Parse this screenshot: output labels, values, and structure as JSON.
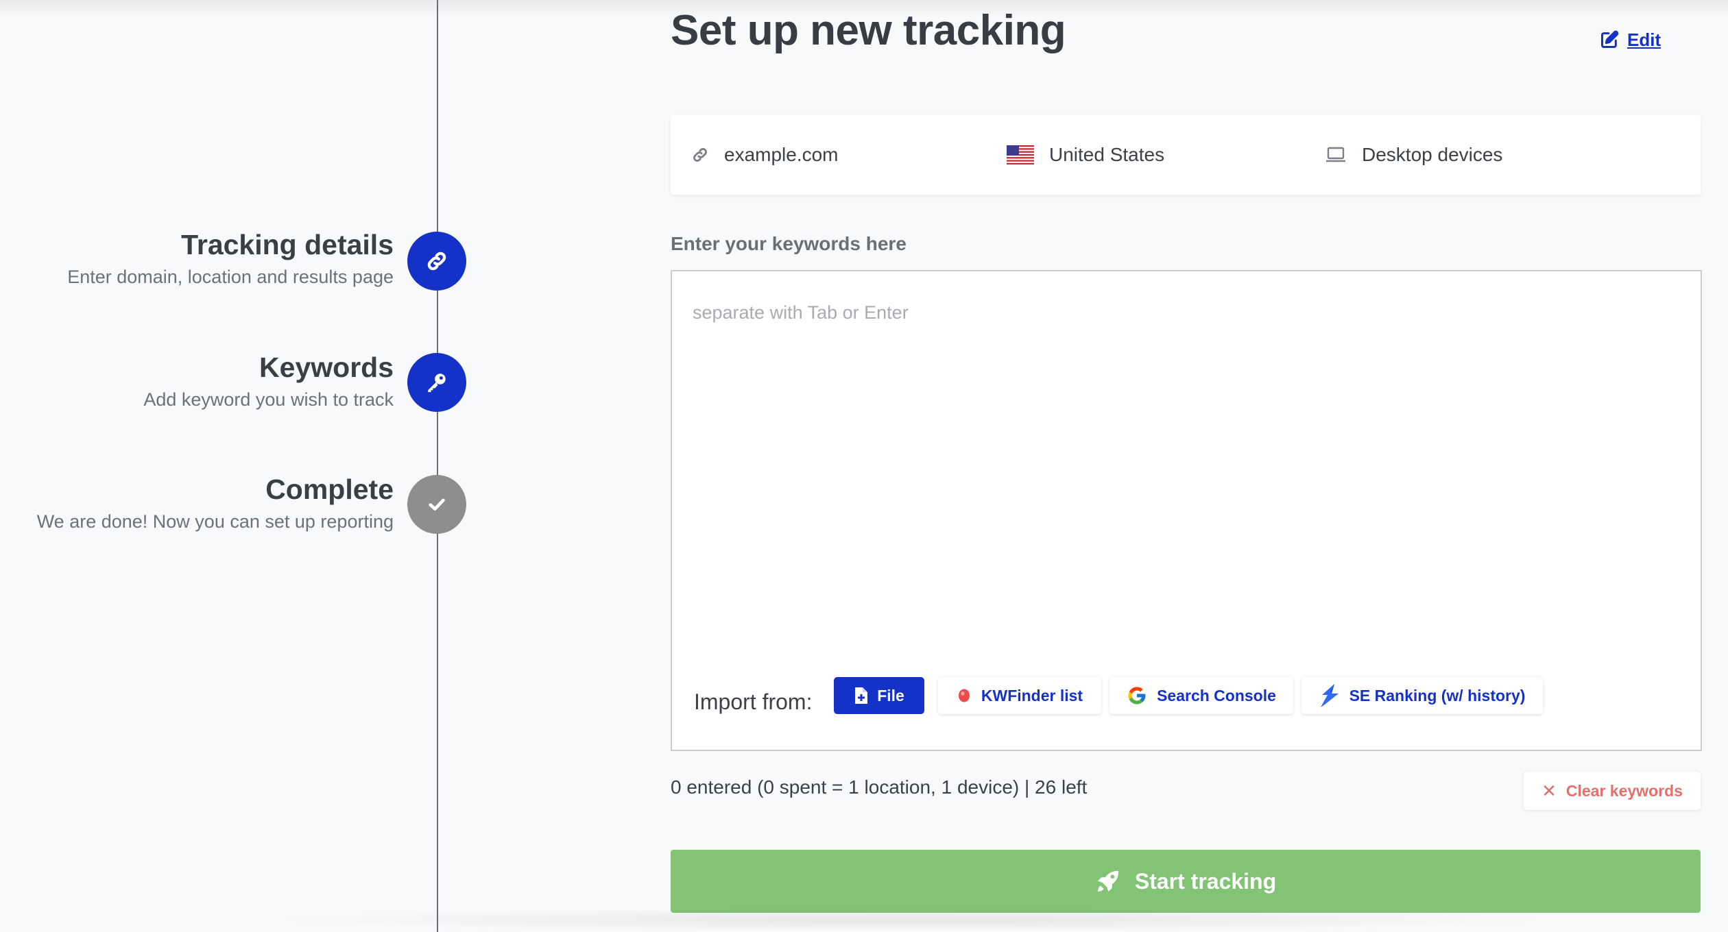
{
  "page": {
    "title": "Set up new tracking"
  },
  "steps": [
    {
      "title": "Tracking details",
      "subtitle": "Enter domain, location and results page",
      "icon": "link-icon",
      "state": "active"
    },
    {
      "title": "Keywords",
      "subtitle": "Add keyword you wish to track",
      "icon": "key-icon",
      "state": "active"
    },
    {
      "title": "Complete",
      "subtitle": "We are done! Now you can set up reporting",
      "icon": "check-icon",
      "state": "done"
    }
  ],
  "summary": {
    "domain": "example.com",
    "location": "United States",
    "device": "Desktop devices",
    "edit_label": "Edit"
  },
  "keywords": {
    "label": "Enter your keywords here",
    "value": "",
    "placeholder": "separate with Tab or Enter"
  },
  "import": {
    "label": "Import from:",
    "buttons": [
      {
        "label": "File",
        "icon": "file-add-icon"
      },
      {
        "label": "KWFinder list",
        "icon": "kwfinder-icon"
      },
      {
        "label": "Search Console",
        "icon": "google-icon"
      },
      {
        "label": "SE Ranking (w/ history)",
        "icon": "se-ranking-icon"
      }
    ]
  },
  "counter": {
    "text": "0 entered (0 spent = 1 location, 1 device) | 26 left"
  },
  "actions": {
    "clear_label": "Clear keywords",
    "start_label": "Start tracking"
  },
  "colors": {
    "primary": "#1431c8",
    "start_button": "#82c376",
    "clear_text": "#e46f6a",
    "done_step": "#8e8e8e"
  }
}
